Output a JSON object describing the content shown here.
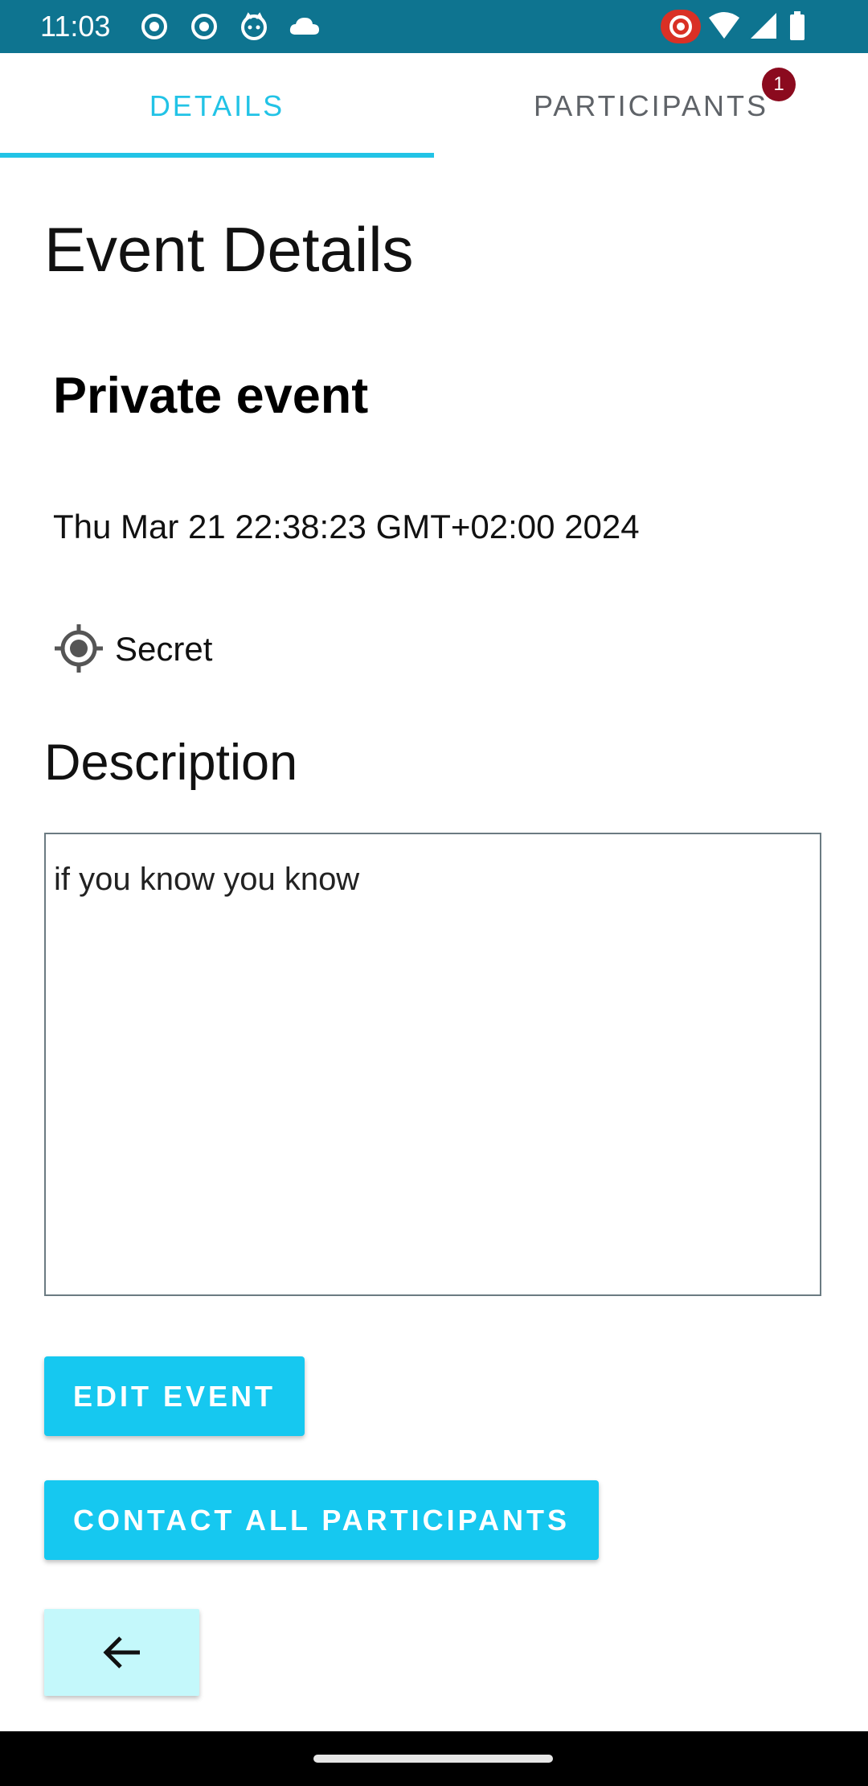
{
  "status_bar": {
    "time": "11:03",
    "icons": [
      "record-icon",
      "record-icon",
      "cat-icon",
      "cloud-icon",
      "cast-record-icon",
      "wifi-icon",
      "signal-icon",
      "battery-icon"
    ],
    "background": "#0e7490"
  },
  "tabs": [
    {
      "label": "DETAILS",
      "selected": true
    },
    {
      "label": "PARTICIPANTS",
      "selected": false,
      "badge": "1"
    }
  ],
  "page_title": "Event Details",
  "event": {
    "name": "Private event",
    "date": "Thu Mar 21 22:38:23 GMT+02:00 2024",
    "location_icon": "location-target-icon",
    "location": "Secret"
  },
  "description": {
    "title": "Description",
    "text": "if you know you know"
  },
  "buttons": {
    "edit": "EDIT EVENT",
    "contact": "CONTACT ALL PARTICIPANTS",
    "back_icon": "arrow-back-icon"
  },
  "colors": {
    "accent": "#22c3e6",
    "button": "#16c8f0",
    "back_button": "#c4f8fb",
    "badge": "#8b0a1e"
  }
}
